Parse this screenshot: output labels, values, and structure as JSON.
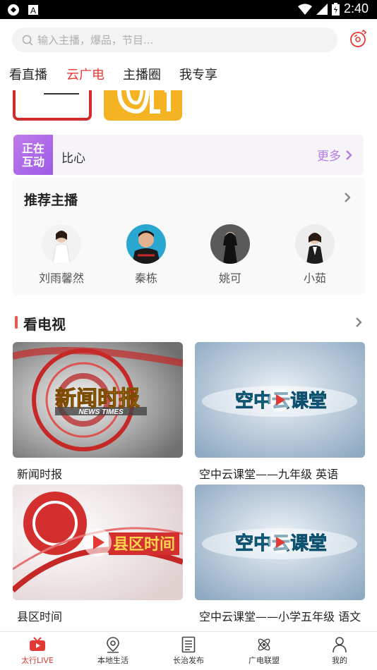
{
  "status_bar": {
    "time": "2:40"
  },
  "search": {
    "placeholder": "输入主播，爆品，节目..."
  },
  "tabs": [
    {
      "label": "看直播",
      "active": false
    },
    {
      "label": "云广电",
      "active": true
    },
    {
      "label": "主播圈",
      "active": false
    },
    {
      "label": "我专享",
      "active": false
    }
  ],
  "live_strip": {
    "tag_line1": "正在",
    "tag_line2": "互动",
    "name": "比心",
    "more": "更多"
  },
  "anchors": {
    "title": "推荐主播",
    "items": [
      {
        "name": "刘雨馨然"
      },
      {
        "name": "秦栋"
      },
      {
        "name": "姚可"
      },
      {
        "name": "小茹"
      }
    ]
  },
  "tv": {
    "title": "看电视",
    "cards": [
      {
        "caption": "新闻时报",
        "thumb_text": "新闻时报",
        "thumb_sub": "NEWS TIMES"
      },
      {
        "caption": "空中云课堂——九年级 英语",
        "thumb_text": "空中云课堂"
      },
      {
        "caption": "县区时间",
        "thumb_text": "县区时间"
      },
      {
        "caption": "空中云课堂——小学五年级 语文",
        "thumb_text": "空中云课堂"
      }
    ]
  },
  "bottom_nav": [
    {
      "label": "太行LIVE",
      "icon": "tv-icon",
      "active": true
    },
    {
      "label": "本地生活",
      "icon": "location-icon",
      "active": false
    },
    {
      "label": "长治发布",
      "icon": "document-icon",
      "active": false
    },
    {
      "label": "广电联盟",
      "icon": "atom-icon",
      "active": false
    },
    {
      "label": "我的",
      "icon": "person-icon",
      "active": false
    }
  ],
  "colors": {
    "accent": "#e53935",
    "live_purple": "#9b5be6"
  }
}
